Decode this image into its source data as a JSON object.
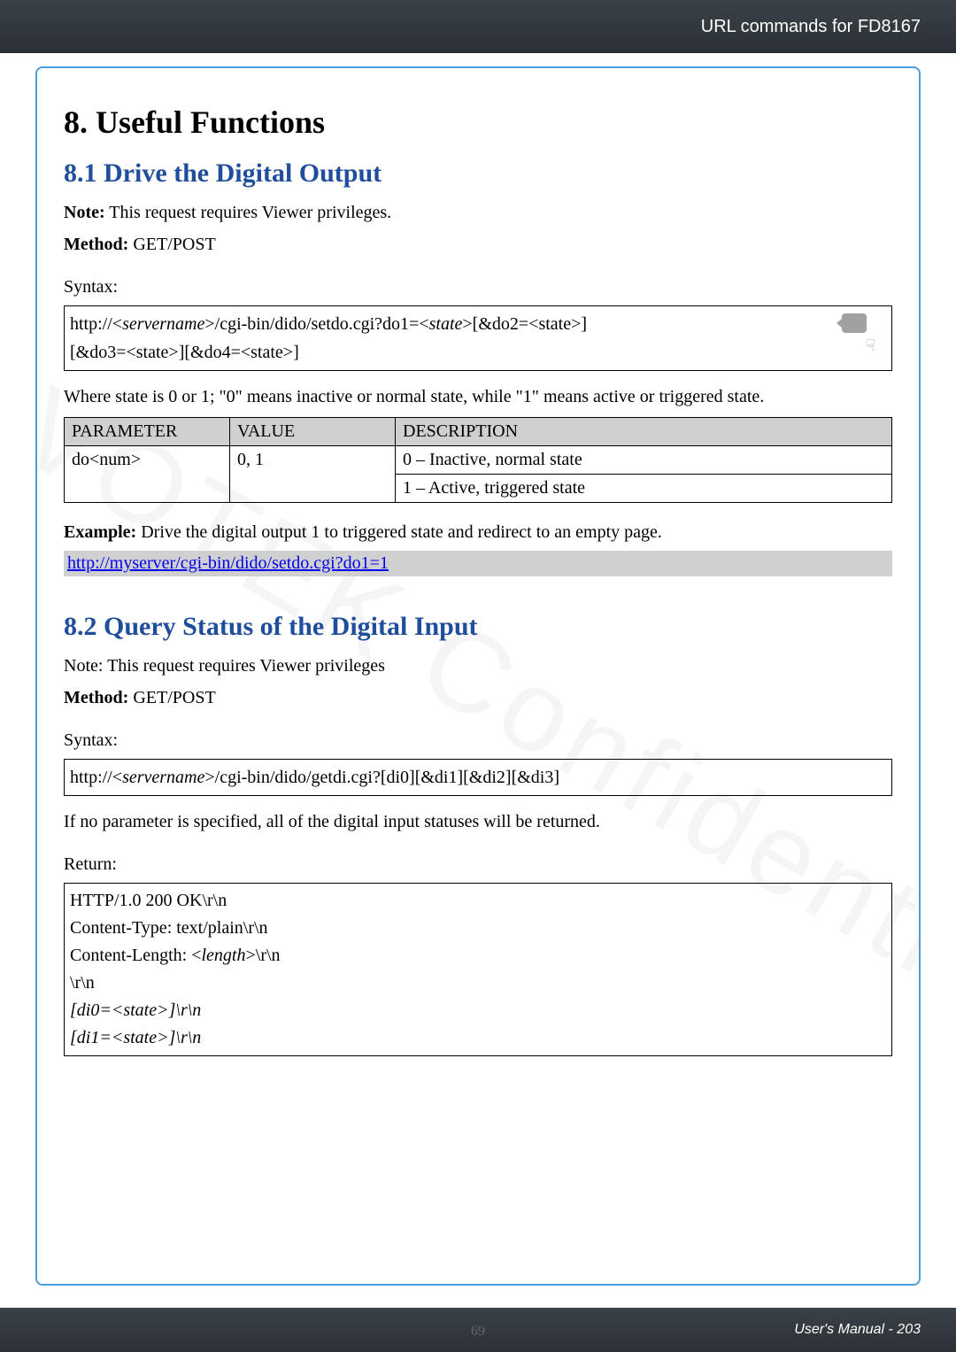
{
  "header": {
    "title": "URL commands for FD8167"
  },
  "chapter": {
    "title": "8. Useful Functions"
  },
  "section1": {
    "title": "8.1 Drive the Digital Output",
    "note_label": "Note:",
    "note_text": " This request requires Viewer privileges.",
    "method_label": "Method:",
    "method_value": " GET/POST",
    "syntax_label": "Syntax:",
    "syntax_line1_a": "http://<",
    "syntax_line1_b": "servername",
    "syntax_line1_c": ">/cgi-bin/dido/setdo.cgi?do1=<",
    "syntax_line1_d": "state",
    "syntax_line1_e": ">[&do2=<state>]",
    "syntax_line2": "[&do3=<state>][&do4=<state>]",
    "where_text": "Where state is 0 or 1; \"0\" means inactive or normal state, while \"1\" means active or triggered state.",
    "table": {
      "headers": [
        "PARAMETER",
        "VALUE",
        "DESCRIPTION"
      ],
      "rows": [
        {
          "param": "do<num>",
          "value": "0, 1",
          "desc1": "0 – Inactive, normal state",
          "desc2": "1 – Active, triggered state"
        }
      ]
    },
    "example_label": "Example:",
    "example_text": " Drive the digital output 1 to triggered state and redirect to an empty page.",
    "example_link": "http://myserver/cgi-bin/dido/setdo.cgi?do1=1"
  },
  "section2": {
    "title": "8.2 Query Status of the Digital Input",
    "note_text": "Note: This request requires Viewer privileges",
    "method_label": "Method:",
    "method_value": " GET/POST",
    "syntax_label": "Syntax:",
    "syntax_line_a": "http://<",
    "syntax_line_b": "servername",
    "syntax_line_c": ">/cgi-bin/dido/getdi.cgi?[di0][&di1][&di2][&di3]",
    "if_text": "If no parameter is specified, all of the digital input statuses will be returned.",
    "return_label": "Return:",
    "return_lines": [
      "HTTP/1.0 200 OK\\r\\n",
      "Content-Type: text/plain\\r\\n",
      "Content-Length: <length>\\r\\n",
      "\\r\\n",
      "[di0=<state>]\\r\\n",
      "[di1=<state>]\\r\\n"
    ],
    "return_length_italic": "length",
    "return_state_italic": "state"
  },
  "footer": {
    "center_page": "69",
    "right_text": "User's Manual - 203"
  },
  "watermark_big": "VIVOTEK Confidential"
}
